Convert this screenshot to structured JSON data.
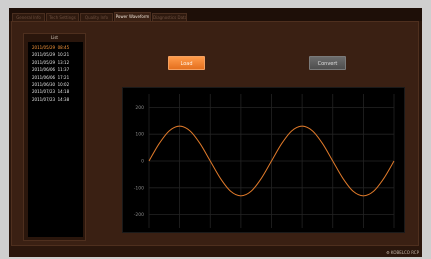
{
  "tabs": [
    {
      "label": "General Info"
    },
    {
      "label": "Tech Settings"
    },
    {
      "label": "Quality Info"
    },
    {
      "label": "Power Waveform"
    },
    {
      "label": "Diagnostics Data"
    }
  ],
  "active_tab_index": 3,
  "list": {
    "title": "List",
    "items": [
      {
        "text": "2011/05/29  08:45",
        "selected": true
      },
      {
        "text": "2011/05/29  10:21",
        "selected": false
      },
      {
        "text": "2011/05/29  13:12",
        "selected": false
      },
      {
        "text": "2011/06/06  11:37",
        "selected": false
      },
      {
        "text": "2011/06/06  17:21",
        "selected": false
      },
      {
        "text": "2011/06/30  10:02",
        "selected": false
      },
      {
        "text": "2011/07/23  14:18",
        "selected": false
      },
      {
        "text": "2011/07/23  14:38",
        "selected": false
      }
    ]
  },
  "buttons": {
    "load_label": "Load",
    "convert_label": "Convert"
  },
  "footer": {
    "logo_text": "⚙ KOBELCO RCP"
  },
  "colors": {
    "accent": "#ff8a2a",
    "background": "#2a160c",
    "panel": "#3a2013",
    "curve": "#e07a2a"
  },
  "chart_data": {
    "type": "line",
    "title": "",
    "xlabel": "",
    "ylabel": "",
    "y_ticks": [
      "200",
      "100",
      "0",
      "-100",
      "-200"
    ],
    "ylim": [
      -250,
      250
    ],
    "xlim": [
      0,
      720
    ],
    "grid": true,
    "series": [
      {
        "x": [
          0,
          30,
          60,
          90,
          120,
          150,
          180,
          210,
          240,
          270,
          300,
          330,
          360,
          390,
          420,
          450,
          480,
          510,
          540,
          570,
          600,
          630,
          660,
          690,
          720
        ],
        "y": [
          0,
          65,
          113,
          130,
          113,
          65,
          0,
          -65,
          -113,
          -130,
          -113,
          -65,
          0,
          65,
          113,
          130,
          113,
          65,
          0,
          -65,
          -113,
          -130,
          -113,
          -65,
          0
        ]
      }
    ]
  }
}
